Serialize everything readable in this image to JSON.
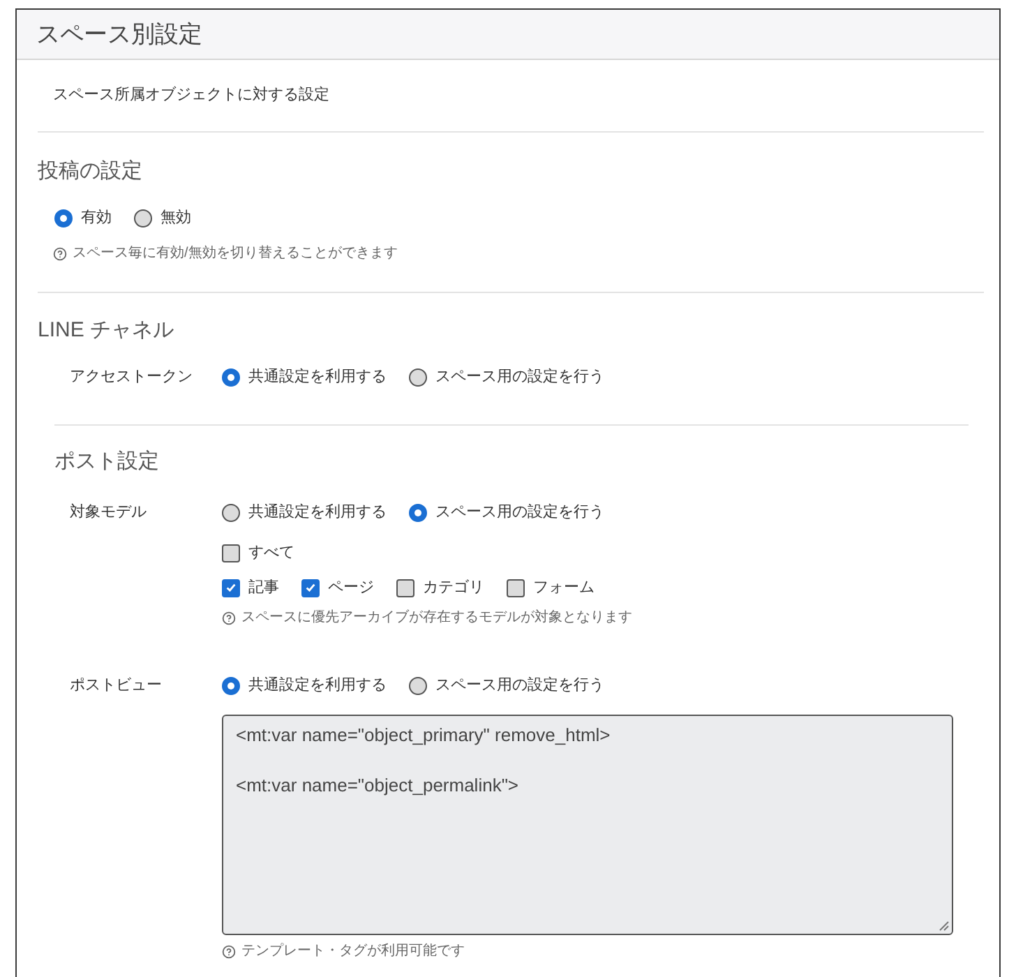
{
  "panel": {
    "title": "スペース別設定"
  },
  "description": "スペース所属オブジェクトに対する設定",
  "sections": [
    {
      "kind": "toggle",
      "heading": "投稿の設定",
      "options": [
        {
          "label": "有効",
          "selected": true
        },
        {
          "label": "無効",
          "selected": false
        }
      ],
      "help": "スペース毎に有効/無効を切り替えることができます"
    },
    {
      "kind": "fields",
      "heading": "LINE チャネル",
      "fields": [
        {
          "label": "アクセストークン",
          "options": [
            {
              "label": "共通設定を利用する",
              "selected": true
            },
            {
              "label": "スペース用の設定を行う",
              "selected": false
            }
          ]
        }
      ],
      "subsections": [
        {
          "heading": "ポスト設定",
          "fields": [
            {
              "label": "対象モデル",
              "options": [
                {
                  "label": "共通設定を利用する",
                  "selected": false
                },
                {
                  "label": "スペース用の設定を行う",
                  "selected": true
                }
              ],
              "checkbox_rows": [
                [
                  {
                    "label": "すべて",
                    "checked": false
                  }
                ],
                [
                  {
                    "label": "記事",
                    "checked": true
                  },
                  {
                    "label": "ページ",
                    "checked": true
                  },
                  {
                    "label": "カテゴリ",
                    "checked": false
                  },
                  {
                    "label": "フォーム",
                    "checked": false
                  }
                ]
              ],
              "help": "スペースに優先アーカイブが存在するモデルが対象となります"
            },
            {
              "label": "ポストビュー",
              "options": [
                {
                  "label": "共通設定を利用する",
                  "selected": true
                },
                {
                  "label": "スペース用の設定を行う",
                  "selected": false
                }
              ],
              "textarea": {
                "value": "<mt:var name=\"object_primary\" remove_html>\n\n<mt:var name=\"object_permalink\">"
              },
              "help": "テンプレート・タグが利用可能です"
            }
          ]
        }
      ]
    }
  ]
}
